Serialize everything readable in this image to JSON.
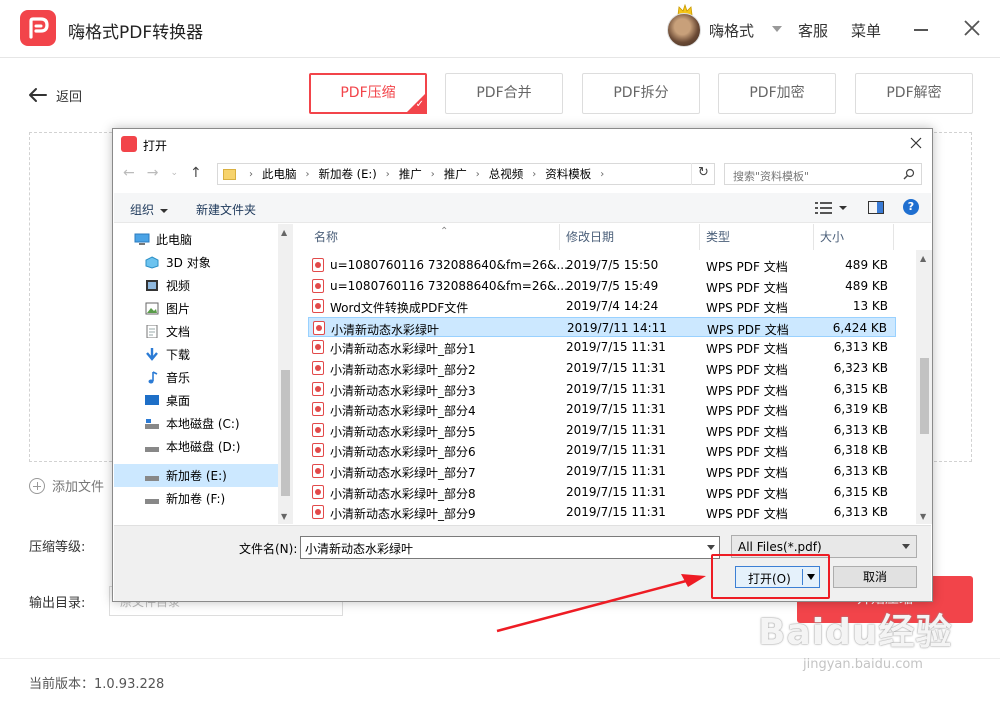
{
  "app": {
    "title": "嗨格式PDF转换器",
    "username": "嗨格式",
    "service": "客服",
    "menu": "菜单",
    "back": "返回",
    "tabs": [
      {
        "label": "PDF压缩",
        "active": true
      },
      {
        "label": "PDF合并",
        "active": false
      },
      {
        "label": "PDF拆分",
        "active": false
      },
      {
        "label": "PDF加密",
        "active": false
      },
      {
        "label": "PDF解密",
        "active": false
      }
    ],
    "add_file": "添加文件",
    "compress_level_label": "压缩等级:",
    "output_dir_label": "输出目录:",
    "output_dir_placeholder": "原文件目录",
    "start_button": "开始压缩",
    "version": "当前版本：1.0.93.228",
    "accent_color": "#f2444a"
  },
  "dialog": {
    "title": "打开",
    "breadcrumb": [
      "此电脑",
      "新加卷 (E:)",
      "推广",
      "推广",
      "总视频",
      "资料模板"
    ],
    "search_placeholder": "搜索\"资料模板\"",
    "organize": "组织",
    "new_folder": "新建文件夹",
    "nav_items": [
      {
        "label": "此电脑",
        "icon": "computer-icon",
        "selected": false
      },
      {
        "label": "3D 对象",
        "icon": "3d-objects-icon",
        "selected": false
      },
      {
        "label": "视频",
        "icon": "video-icon",
        "selected": false
      },
      {
        "label": "图片",
        "icon": "picture-icon",
        "selected": false
      },
      {
        "label": "文档",
        "icon": "document-icon",
        "selected": false
      },
      {
        "label": "下载",
        "icon": "download-icon",
        "selected": false
      },
      {
        "label": "音乐",
        "icon": "music-icon",
        "selected": false
      },
      {
        "label": "桌面",
        "icon": "desktop-icon",
        "selected": false
      },
      {
        "label": "本地磁盘 (C:)",
        "icon": "drive-icon",
        "selected": false
      },
      {
        "label": "本地磁盘 (D:)",
        "icon": "drive-icon",
        "selected": false
      },
      {
        "label": "新加卷 (E:)",
        "icon": "drive-icon",
        "selected": true
      },
      {
        "label": "新加卷 (F:)",
        "icon": "drive-icon",
        "selected": false
      }
    ],
    "columns": [
      "名称",
      "修改日期",
      "类型",
      "大小"
    ],
    "files": [
      {
        "name": "u=1080760116 732088640&fm=26&...",
        "date": "2019/7/5 15:50",
        "type": "WPS PDF 文档",
        "size": "489 KB",
        "selected": false
      },
      {
        "name": "u=1080760116 732088640&fm=26&...",
        "date": "2019/7/5 15:49",
        "type": "WPS PDF 文档",
        "size": "489 KB",
        "selected": false
      },
      {
        "name": "Word文件转换成PDF文件",
        "date": "2019/7/4 14:24",
        "type": "WPS PDF 文档",
        "size": "13 KB",
        "selected": false
      },
      {
        "name": "小清新动态水彩绿叶",
        "date": "2019/7/11 14:11",
        "type": "WPS PDF 文档",
        "size": "6,424 KB",
        "selected": true
      },
      {
        "name": "小清新动态水彩绿叶_部分1",
        "date": "2019/7/15 11:31",
        "type": "WPS PDF 文档",
        "size": "6,313 KB",
        "selected": false
      },
      {
        "name": "小清新动态水彩绿叶_部分2",
        "date": "2019/7/15 11:31",
        "type": "WPS PDF 文档",
        "size": "6,323 KB",
        "selected": false
      },
      {
        "name": "小清新动态水彩绿叶_部分3",
        "date": "2019/7/15 11:31",
        "type": "WPS PDF 文档",
        "size": "6,315 KB",
        "selected": false
      },
      {
        "name": "小清新动态水彩绿叶_部分4",
        "date": "2019/7/15 11:31",
        "type": "WPS PDF 文档",
        "size": "6,319 KB",
        "selected": false
      },
      {
        "name": "小清新动态水彩绿叶_部分5",
        "date": "2019/7/15 11:31",
        "type": "WPS PDF 文档",
        "size": "6,313 KB",
        "selected": false
      },
      {
        "name": "小清新动态水彩绿叶_部分6",
        "date": "2019/7/15 11:31",
        "type": "WPS PDF 文档",
        "size": "6,318 KB",
        "selected": false
      },
      {
        "name": "小清新动态水彩绿叶_部分7",
        "date": "2019/7/15 11:31",
        "type": "WPS PDF 文档",
        "size": "6,313 KB",
        "selected": false
      },
      {
        "name": "小清新动态水彩绿叶_部分8",
        "date": "2019/7/15 11:31",
        "type": "WPS PDF 文档",
        "size": "6,315 KB",
        "selected": false
      },
      {
        "name": "小清新动态水彩绿叶_部分9",
        "date": "2019/7/15 11:31",
        "type": "WPS PDF 文档",
        "size": "6,313 KB",
        "selected": false
      }
    ],
    "filename_label": "文件名(N):",
    "filename_value": "小清新动态水彩绿叶",
    "filetype_value": "All Files(*.pdf)",
    "open_button": "打开(O)",
    "cancel_button": "取消"
  },
  "watermark": {
    "text": "Baidu经验",
    "url": "jingyan.baidu.com"
  }
}
